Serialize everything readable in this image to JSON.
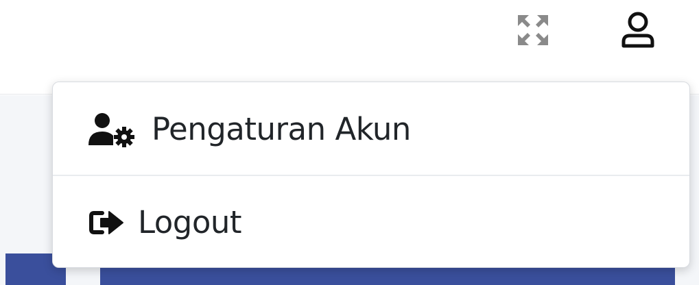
{
  "navbar": {
    "icons": {
      "fullscreen": "expand-arrows-icon",
      "user": "user-outline-icon"
    }
  },
  "dropdown": {
    "items": [
      {
        "label": "Pengaturan Akun",
        "icon": "user-gear-icon"
      },
      {
        "label": "Logout",
        "icon": "sign-out-icon"
      }
    ]
  },
  "colors": {
    "accent_blue": "#3a4f9c",
    "icon_gray": "#8a8a8a",
    "text": "#212529",
    "background": "#f4f6f9"
  }
}
